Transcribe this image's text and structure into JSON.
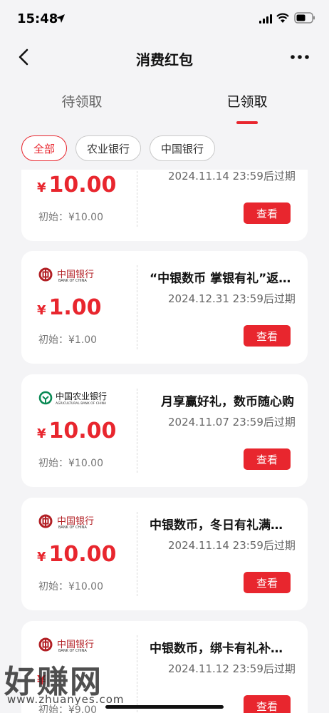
{
  "status_bar": {
    "time": "15:48",
    "icons": [
      "location-arrow-icon",
      "signal-icon",
      "wifi-icon",
      "battery-icon"
    ]
  },
  "header": {
    "title": "消费红包",
    "back_icon": "chevron-left-icon",
    "more_icon": "more-dots-icon"
  },
  "tabs": [
    {
      "label": "待领取",
      "active": false
    },
    {
      "label": "已领取",
      "active": true
    }
  ],
  "filters": [
    {
      "label": "全部",
      "active": true
    },
    {
      "label": "农业银行",
      "active": false
    },
    {
      "label": "中国银行",
      "active": false
    }
  ],
  "coupons": [
    {
      "bank": "",
      "amount": "10.00",
      "currency": "¥",
      "initial": "初始：¥10.00",
      "title": "",
      "expiry": "2024.11.14 23:59后过期",
      "button": "查看"
    },
    {
      "bank": "中国银行",
      "bank_logo_text": "中国银行",
      "bank_logo_en": "BANK OF CHINA",
      "amount": "1.00",
      "currency": "¥",
      "initial": "初始：¥1.00",
      "title": "“中银数币 掌银有礼”返…",
      "expiry": "2024.12.31 23:59后过期",
      "button": "查看"
    },
    {
      "bank": "中国农业银行",
      "bank_logo_text": "中国农业银行",
      "bank_logo_en": "AGRICULTURAL BANK OF CHINA",
      "amount": "10.00",
      "currency": "¥",
      "initial": "初始：¥10.00",
      "title": "月享赢好礼，数币随心购",
      "expiry": "2024.11.07 23:59后过期",
      "button": "查看"
    },
    {
      "bank": "中国银行",
      "bank_logo_text": "中国银行",
      "bank_logo_en": "BANK OF CHINA",
      "amount": "10.00",
      "currency": "¥",
      "initial": "初始：¥10.00",
      "title": "中银数币，冬日有礼满…",
      "expiry": "2024.11.14 23:59后过期",
      "button": "查看"
    },
    {
      "bank": "中国银行",
      "bank_logo_text": "中国银行",
      "bank_logo_en": "BANK OF CHINA",
      "amount": "",
      "currency": "¥",
      "initial": "初始：¥9.00",
      "title": "中银数币，绑卡有礼补…",
      "expiry": "2024.11.12 23:59后过期",
      "button": "查看"
    }
  ],
  "watermark": {
    "text": "好赚网",
    "url": "www.zhuanyes.com"
  },
  "colors": {
    "accent": "#e8262e",
    "background": "#f4f4f6",
    "card": "#ffffff"
  }
}
